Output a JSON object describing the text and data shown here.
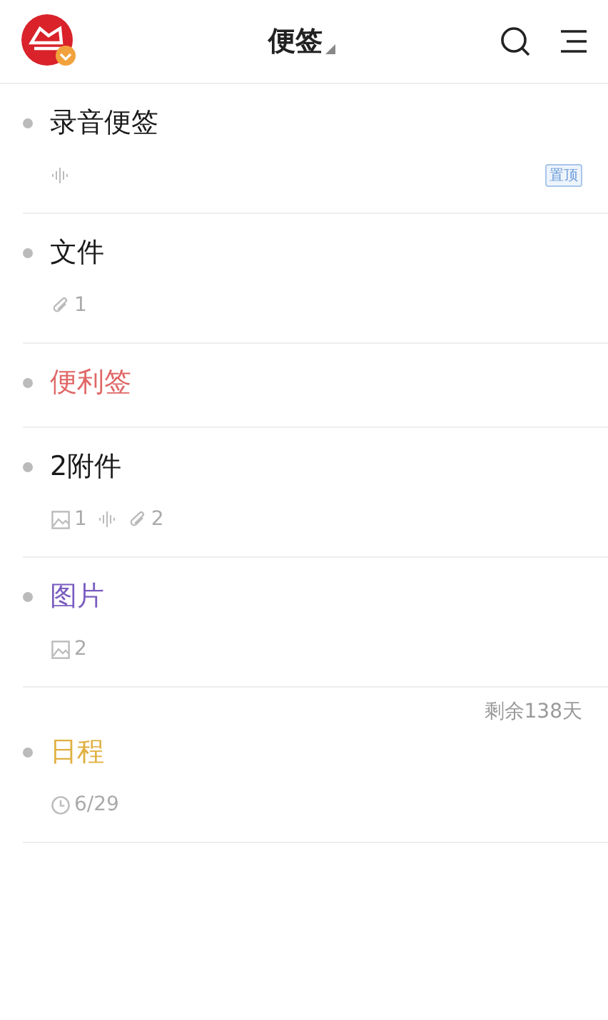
{
  "header": {
    "title": "便签"
  },
  "notes": [
    {
      "title": "录音便签",
      "color": "#1a1a1a",
      "meta": [
        {
          "kind": "audio"
        }
      ],
      "tag": "置顶"
    },
    {
      "title": "文件",
      "color": "#1a1a1a",
      "meta": [
        {
          "kind": "attachment",
          "count": "1"
        }
      ]
    },
    {
      "title": "便利签",
      "color": "#e06666"
    },
    {
      "title": "2附件",
      "color": "#1a1a1a",
      "meta": [
        {
          "kind": "image",
          "count": "1"
        },
        {
          "kind": "audio"
        },
        {
          "kind": "attachment",
          "count": "2"
        }
      ]
    },
    {
      "title": "图片",
      "color": "#7a5cc0",
      "meta": [
        {
          "kind": "image",
          "count": "2"
        }
      ]
    },
    {
      "title": "日程",
      "color": "#e0b040",
      "remaining": "剩余138天",
      "meta": [
        {
          "kind": "clock",
          "count": "6/29"
        }
      ]
    }
  ]
}
